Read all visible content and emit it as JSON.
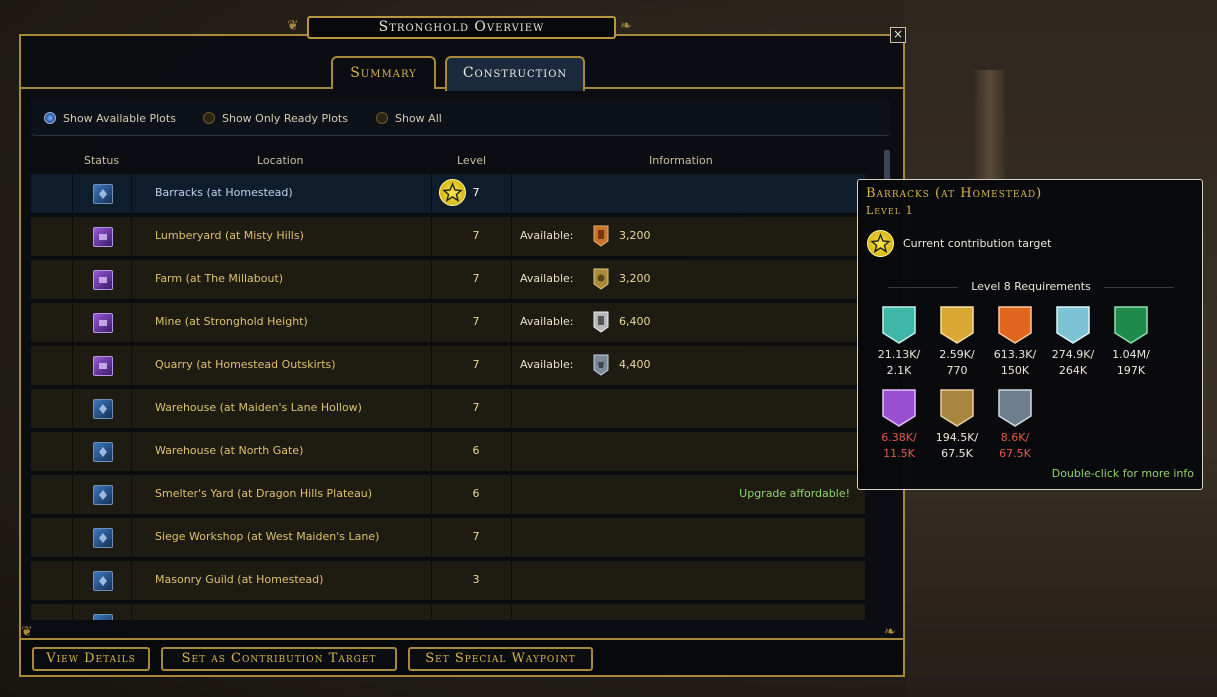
{
  "window": {
    "title": "Stronghold Overview",
    "close": "×"
  },
  "tabs": [
    {
      "label": "Summary"
    },
    {
      "label": "Construction"
    }
  ],
  "filters": [
    {
      "label": "Show Available Plots",
      "selected": true
    },
    {
      "label": "Show Only Ready Plots",
      "selected": false
    },
    {
      "label": "Show All",
      "selected": false
    }
  ],
  "columns": {
    "status": "Status",
    "location": "Location",
    "level": "Level",
    "information": "Information"
  },
  "rows": [
    {
      "status": "blue",
      "location": "Barracks (at Homestead)",
      "level": "7",
      "contribution_target": true
    },
    {
      "status": "purple",
      "location": "Lumberyard (at Misty Hills)",
      "level": "7",
      "available": "Available:",
      "resource": "timber-icon",
      "value": "3,200"
    },
    {
      "status": "purple",
      "location": "Farm (at The Millabout)",
      "level": "7",
      "available": "Available:",
      "resource": "food-icon",
      "value": "3,200"
    },
    {
      "status": "purple",
      "location": "Mine (at Stronghold Height)",
      "level": "7",
      "available": "Available:",
      "resource": "iron-icon",
      "value": "6,400"
    },
    {
      "status": "purple",
      "location": "Quarry (at Homestead Outskirts)",
      "level": "7",
      "available": "Available:",
      "resource": "stone-icon",
      "value": "4,400"
    },
    {
      "status": "blue",
      "location": "Warehouse (at Maiden's Lane Hollow)",
      "level": "7"
    },
    {
      "status": "blue",
      "location": "Warehouse (at North Gate)",
      "level": "6"
    },
    {
      "status": "blue",
      "location": "Smelter's Yard (at Dragon Hills Plateau)",
      "level": "6",
      "note": "Upgrade affordable!"
    },
    {
      "status": "blue",
      "location": "Siege Workshop (at West Maiden's Lane)",
      "level": "7"
    },
    {
      "status": "blue",
      "location": "Masonry Guild (at Homestead)",
      "level": "3"
    }
  ],
  "buttons": {
    "view_details": "View Details",
    "set_target": "Set as Contribution Target",
    "set_waypoint": "Set Special Waypoint"
  },
  "tooltip": {
    "title": "Barracks (at Homestead)",
    "subtitle": "Level 1",
    "target_text": "Current contribution target",
    "requirements_heading": "Level 8 Requirements",
    "requirements": [
      {
        "icon": "influence-shield-icon",
        "color": "#3fb7a8",
        "line1": "21.13K/",
        "line2": "2.1K",
        "insufficient": false
      },
      {
        "icon": "gold-shield-icon",
        "color": "#d8a832",
        "line1": "2.59K/",
        "line2": "770",
        "insufficient": false
      },
      {
        "icon": "banner-shield-icon",
        "color": "#e0661e",
        "line1": "613.3K/",
        "line2": "150K",
        "insufficient": false
      },
      {
        "icon": "frost-shield-icon",
        "color": "#7cc3d6",
        "line1": "274.9K/",
        "line2": "264K",
        "insufficient": false
      },
      {
        "icon": "tree-shield-icon",
        "color": "#1f8a4a",
        "line1": "1.04M/",
        "line2": "197K",
        "insufficient": false
      },
      {
        "icon": "crystal-shield-icon",
        "color": "#9a4ed0",
        "line1": "6.38K/",
        "line2": "11.5K",
        "insufficient": true
      },
      {
        "icon": "wood-shield-icon",
        "color": "#a8863e",
        "line1": "194.5K/",
        "line2": "67.5K",
        "insufficient": false
      },
      {
        "icon": "stone-shield-icon",
        "color": "#6d7f8e",
        "line1": "8.6K/",
        "line2": "67.5K",
        "insufficient": true
      }
    ],
    "more_info": "Double-click for more info"
  }
}
